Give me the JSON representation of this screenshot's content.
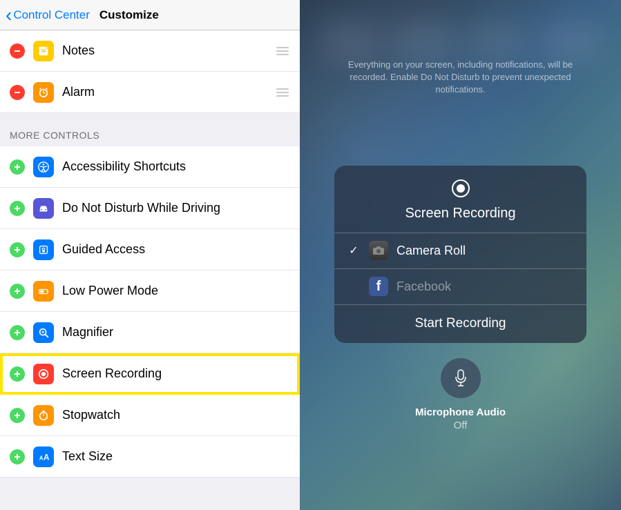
{
  "nav": {
    "back": "Control Center",
    "title": "Customize"
  },
  "included": [
    {
      "label": "Notes",
      "iconColor": "#ffcc00",
      "icon": "notes"
    },
    {
      "label": "Alarm",
      "iconColor": "#ff9500",
      "icon": "alarm"
    }
  ],
  "sectionHeader": "MORE CONTROLS",
  "more": [
    {
      "label": "Accessibility Shortcuts",
      "iconColor": "#007aff",
      "icon": "accessibility",
      "highlighted": false
    },
    {
      "label": "Do Not Disturb While Driving",
      "iconColor": "#5856d6",
      "icon": "car",
      "highlighted": false
    },
    {
      "label": "Guided Access",
      "iconColor": "#007aff",
      "icon": "lock",
      "highlighted": false
    },
    {
      "label": "Low Power Mode",
      "iconColor": "#ff9500",
      "icon": "battery",
      "highlighted": false
    },
    {
      "label": "Magnifier",
      "iconColor": "#007aff",
      "icon": "magnifier",
      "highlighted": false
    },
    {
      "label": "Screen Recording",
      "iconColor": "#ff3b30",
      "icon": "record",
      "highlighted": true
    },
    {
      "label": "Stopwatch",
      "iconColor": "#ff9500",
      "icon": "stopwatch",
      "highlighted": false
    },
    {
      "label": "Text Size",
      "iconColor": "#007aff",
      "icon": "textsize",
      "highlighted": false
    }
  ],
  "cc": {
    "notice": "Everything on your screen, including notifications, will be recorded. Enable Do Not Disturb to prevent unexpected notifications.",
    "title": "Screen Recording",
    "options": [
      {
        "label": "Camera Roll",
        "selected": true,
        "icon": "cameraroll"
      },
      {
        "label": "Facebook",
        "selected": false,
        "icon": "facebook"
      }
    ],
    "startLabel": "Start Recording",
    "micLabel": "Microphone Audio",
    "micStatus": "Off"
  }
}
